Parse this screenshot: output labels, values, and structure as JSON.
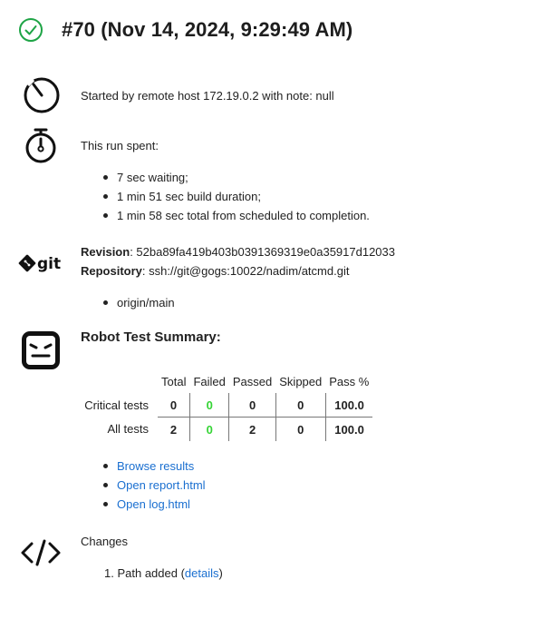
{
  "header": {
    "title": "#70 (Nov 14, 2024, 9:29:49 AM)",
    "status_icon": "check-circle-icon",
    "status_color": "#1ea446"
  },
  "cause": {
    "icon": "stopwatch-icon",
    "text": "Started by remote host 172.19.0.2 with note: null"
  },
  "timing": {
    "icon": "timer-icon",
    "heading": "This run spent:",
    "items": [
      "7 sec waiting;",
      "1 min 51 sec build duration;",
      "1 min 58 sec total from scheduled to completion."
    ]
  },
  "git": {
    "logo": "git",
    "revision_label": "Revision",
    "revision_value": ": 52ba89fa419b403b0391369319e0a35917d12033",
    "repository_label": "Repository",
    "repository_value": ": ssh://git@gogs:10022/nadim/atcmd.git",
    "branches": [
      "origin/main"
    ]
  },
  "robot": {
    "icon": "robot-face-icon",
    "heading": "Robot Test Summary:",
    "columns": [
      "Total",
      "Failed",
      "Passed",
      "Skipped",
      "Pass %"
    ],
    "rows": [
      {
        "label": "Critical tests",
        "total": "0",
        "failed": "0",
        "passed": "0",
        "skipped": "0",
        "pass_pct": "100.0"
      },
      {
        "label": "All tests",
        "total": "2",
        "failed": "0",
        "passed": "2",
        "skipped": "0",
        "pass_pct": "100.0"
      }
    ],
    "failed_color": "#35d435",
    "links": [
      "Browse results",
      "Open report.html",
      "Open log.html"
    ]
  },
  "changes": {
    "icon": "code-brackets-icon",
    "heading": "Changes",
    "item_number": "1.",
    "item_text": "Path added (",
    "item_link": "details",
    "item_end": ")"
  }
}
